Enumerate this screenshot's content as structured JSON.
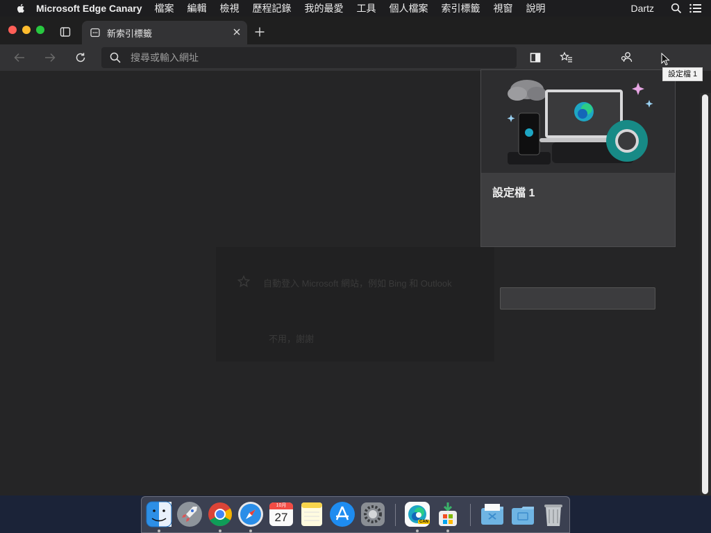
{
  "menubar": {
    "app_name": "Microsoft Edge Canary",
    "items": [
      "檔案",
      "編輯",
      "檢視",
      "歷程記錄",
      "我的最愛",
      "工具",
      "個人檔案",
      "索引標籤",
      "視窗",
      "說明"
    ],
    "user": "Dartz"
  },
  "tab": {
    "title": "新索引標籤"
  },
  "address_bar": {
    "placeholder": "搜尋或輸入網址",
    "value": ""
  },
  "tooltip": {
    "text": "設定檔 1"
  },
  "profile_card": {
    "name": "設定檔 1"
  },
  "signin_prompt": {
    "message": "自動登入 Microsoft 網站，例如 Bing 和 Outlook",
    "decline": "不用，謝謝"
  },
  "dock": {
    "apps": [
      "finder",
      "launchpad",
      "chrome",
      "safari",
      "calendar",
      "notes",
      "app-store",
      "system-preferences",
      "edge-canary",
      "microsoft-installer",
      "downloads-folder",
      "documents-folder",
      "trash"
    ],
    "calendar_day": "27",
    "calendar_month": "10月",
    "edge_badge": "CAN"
  },
  "colors": {
    "accent_edge": "#1ea6c4",
    "window_bg": "#252526",
    "toolbar_bg": "#333335"
  }
}
